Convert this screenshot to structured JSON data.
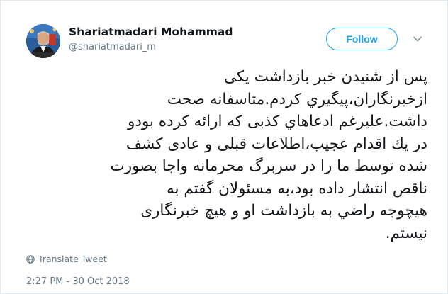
{
  "author": {
    "display_name": "Shariatmadari Mohammad",
    "handle": "@shariatmadari_m"
  },
  "follow_label": "Follow",
  "tweet_text": "پس از شنیدن خبر بازداشت یکی\nازخبرنگاران،پیگیري کردم.متاسفانه صحت\nداشت.علیرغم ادعاهاي کذبی که ارائه کرده بودو\nدر یك اقدام عجیب،اطلاعات قبلی و عادی کشف\nشده توسط ما را در سربرگ محرمانه واجا بصورت\nناقص انتشار داده بود،به مسئولان گفتم به\nهیچوجه راضي به بازداشت او و هیچ خبرنگاری\nنیستم.",
  "translate_label": "Translate Tweet",
  "timestamp": "2:27 PM - 30 Oct 2018",
  "icons": {
    "avatar": "profile-photo",
    "caret": "chevron-down-icon",
    "globe": "globe-icon"
  },
  "colors": {
    "accent": "#1da1f2",
    "text": "#14171a",
    "secondary": "#657786",
    "border": "#e1e8ed"
  }
}
